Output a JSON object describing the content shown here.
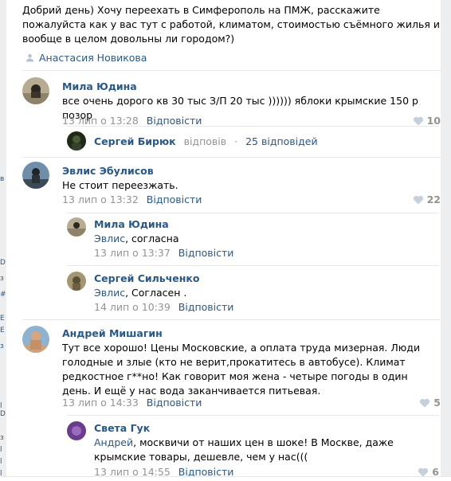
{
  "post": {
    "text": "Добрий день) Хочу переехать в Симферополь на ПМЖ, расскажите пожалуйста как у вас тут с работой, климатом, стоимостью съёмного жилья и вообще в целом довольны ли городом?)",
    "author": "Анастасия Новикова"
  },
  "left_strip": [
    "в",
    "D",
    "з",
    "#",
    "Е",
    "Е",
    "з",
    "l",
    "D",
    "з",
    "l",
    "l",
    "l"
  ],
  "comments": [
    {
      "name": "Мила Юдина",
      "text": "все очень дорого кв 30 тыс З/П 20 тыс )))))) яблоки крымские 150 р позор",
      "date": "13 лип о 13:28",
      "reply_label": "Відповісти",
      "likes": "10",
      "replies_summary": {
        "name": "Сергей Бирюк",
        "verb": "відповів",
        "count": "25 відповідей"
      }
    },
    {
      "name": "Эвлис Эбулисов",
      "text": "Не стоит переезжать.",
      "date": "13 лип о 13:32",
      "reply_label": "Відповісти",
      "likes": "22",
      "replies": [
        {
          "name": "Мила Юдина",
          "to": "Эвлис",
          "text": ", согласна",
          "date": "13 лип о 13:37",
          "reply_label": "Відповісти"
        },
        {
          "name": "Сергей Сильченко",
          "to": "Эвлис",
          "text": ", Согласен .",
          "date": "14 лип о 10:39",
          "reply_label": "Відповісти"
        }
      ]
    },
    {
      "name": "Андрей Мишагин",
      "text": "Тут все хорошо! Цены Московские, а оплата труда мизерная. Люди голодные и злые (кто не верит,прокатитесь в автобусе). Климат редкостное г**но! Как говорит моя жена - четыре погоды в один день. И ещё у нас вода заканчивается питьевая.",
      "date": "13 лип о 14:33",
      "reply_label": "Відповісти",
      "likes": "5",
      "replies": [
        {
          "name": "Света Гук",
          "to": "Андрей",
          "text": ", москвичи от наших цен в шоке! В Москве, даже крымские товары, дешевле, чем у нас(((",
          "date": "13 лип о 14:55",
          "reply_label": "Відповісти",
          "likes": "6"
        }
      ]
    }
  ]
}
